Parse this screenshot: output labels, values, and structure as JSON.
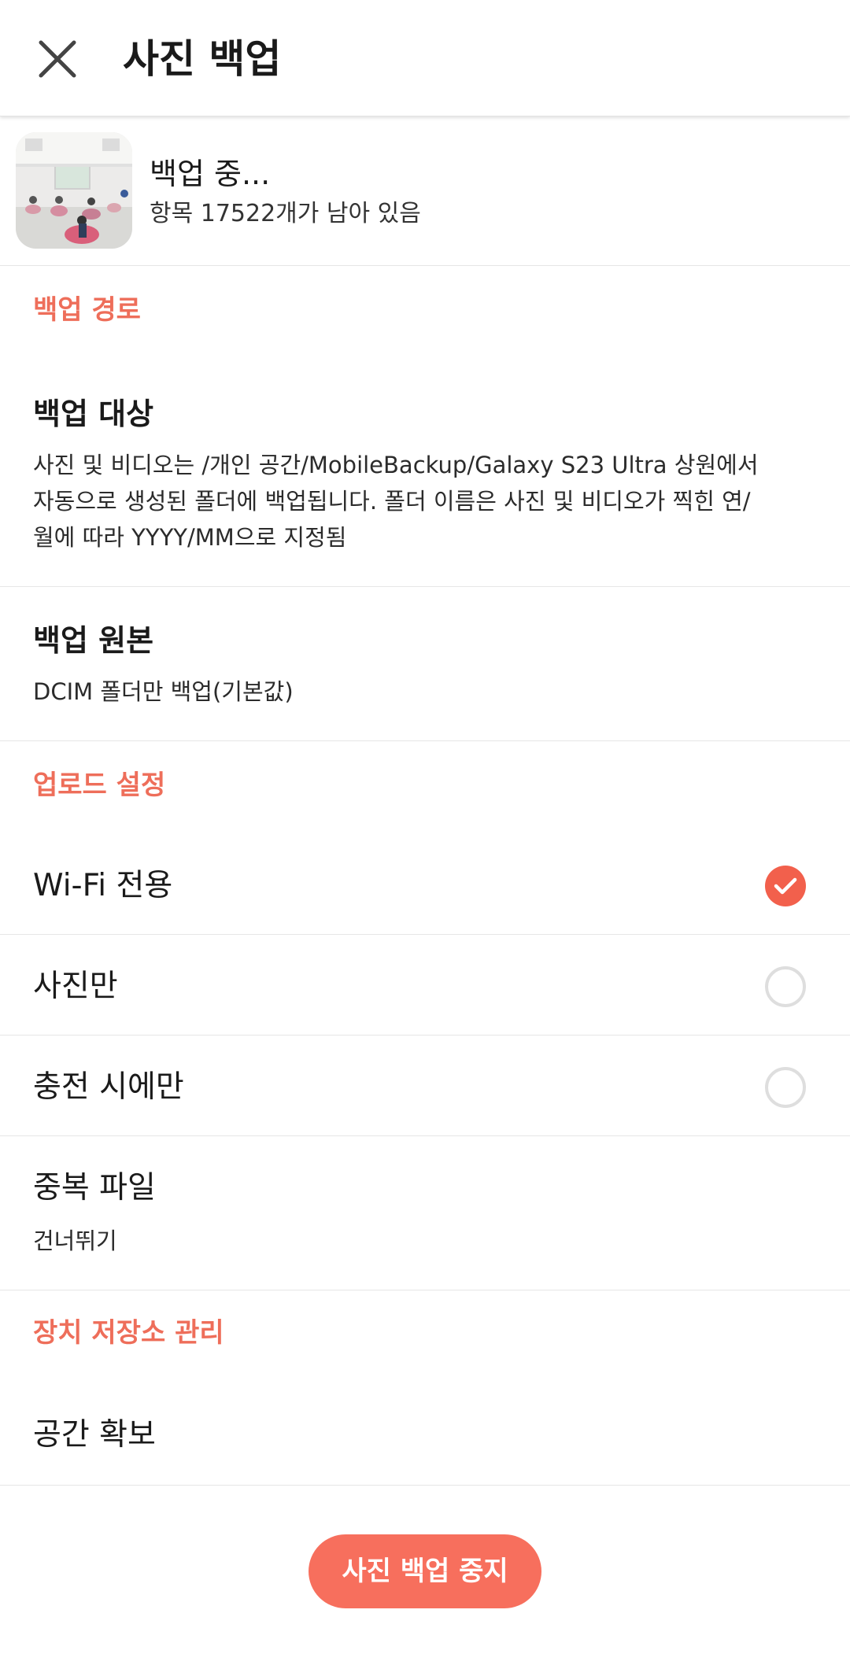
{
  "header": {
    "title": "사진 백업"
  },
  "status": {
    "title": "백업 중...",
    "subtitle": "항목 17522개가 남아 있음"
  },
  "sections": {
    "backup_path": "백업 경로",
    "upload_settings": "업로드 설정",
    "storage": "장치 저장소 관리"
  },
  "backup_target": {
    "title": "백업 대상",
    "desc_line1": "사진 및 비디오는 /개인 공간/MobileBackup/Galaxy S23 Ultra 상원에서",
    "desc_line2": "자동으로 생성된 폴더에 백업됩니다. 폴더 이름은 사진 및 비디오가 찍힌 연/",
    "desc_line3": "월에 따라 YYYY/MM으로 지정됨"
  },
  "backup_source": {
    "title": "백업 원본",
    "value": "DCIM 폴더만 백업(기본값)"
  },
  "options": {
    "wifi_only": {
      "label": "Wi-Fi 전용",
      "checked": true
    },
    "photos_only": {
      "label": "사진만",
      "checked": false
    },
    "charging_only": {
      "label": "충전 시에만",
      "checked": false
    }
  },
  "duplicates": {
    "title": "중복 파일",
    "value": "건너뛰기"
  },
  "free_space": {
    "title": "공간 확보"
  },
  "stop_button": {
    "label": "사진 백업 중지"
  },
  "colors": {
    "accent": "#ee6e5a",
    "button": "#f76f5d",
    "check": "#f2604c"
  },
  "icons": {
    "close": "close-icon",
    "check": "checkmark-icon"
  }
}
